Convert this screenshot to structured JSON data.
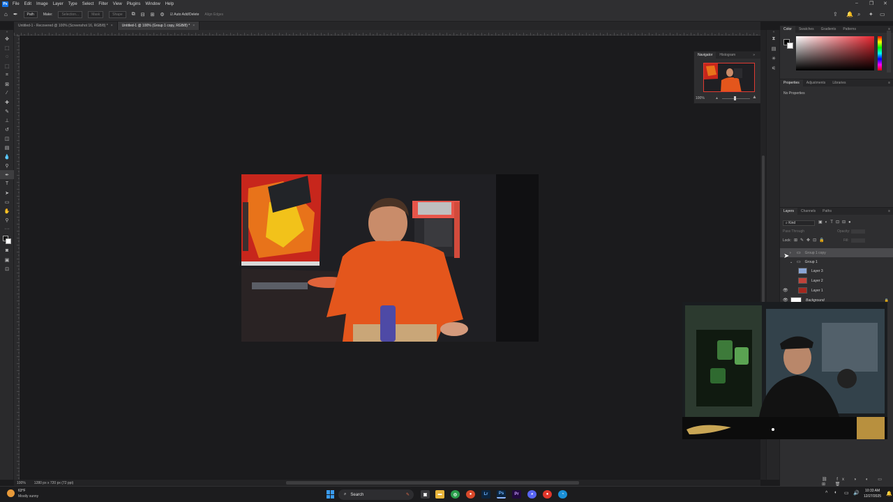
{
  "menubar": {
    "app_icon": "Ps",
    "items": [
      "File",
      "Edit",
      "Image",
      "Layer",
      "Type",
      "Select",
      "Filter",
      "View",
      "Plugins",
      "Window",
      "Help"
    ]
  },
  "options": {
    "home_icon": "home-icon",
    "tool_icon": "pen-icon",
    "mode_value": "Path",
    "make_label": "Make:",
    "selection_label": "Selection...",
    "mask_label": "Mask",
    "shape_label": "Shape",
    "auto_add_delete_label": "Auto Add/Delete",
    "align_edges_label": "Align Edges"
  },
  "tabs": [
    {
      "label": "Untitled-1 - Recovered @ 100% (Screenshot 16, RGB/8) *"
    },
    {
      "label": "Untitled-1 @ 100% (Group 1 copy, RGB/8) *"
    }
  ],
  "navigator": {
    "tabs": [
      "Navigator",
      "Histogram"
    ],
    "zoom": "100%"
  },
  "color_panel": {
    "tabs": [
      "Color",
      "Swatches",
      "Gradients",
      "Patterns"
    ],
    "hue_color": "#e8252f"
  },
  "properties_panel": {
    "tabs": [
      "Properties",
      "Adjustments",
      "Libraries"
    ],
    "empty_text": "No Properties"
  },
  "layers_panel": {
    "tabs": [
      "Layers",
      "Channels",
      "Paths"
    ],
    "filter_value": "Kind",
    "blend_mode": "Pass Through",
    "opacity_label": "Opacity:",
    "lock_label": "Lock:",
    "fill_label": "Fill:",
    "layers": [
      {
        "name": "Group 1 copy",
        "type": "group",
        "visible": false,
        "selected": true
      },
      {
        "name": "Group 1",
        "type": "group",
        "visible": false,
        "selected": false
      },
      {
        "name": "Layer 3",
        "type": "layer",
        "visible": false,
        "selected": false
      },
      {
        "name": "Layer 2",
        "type": "layer",
        "visible": false,
        "selected": false
      },
      {
        "name": "Layer 1",
        "type": "layer",
        "visible": true,
        "selected": false
      },
      {
        "name": "Background",
        "type": "background",
        "visible": true,
        "selected": false
      }
    ]
  },
  "status": {
    "zoom": "100%",
    "doc_info": "1280 px x 720 px (72 ppi)"
  },
  "taskbar": {
    "weather_temp": "63°F",
    "weather_desc": "Mostly sunny",
    "search_label": "Search",
    "clock_time": "10:33 AM",
    "clock_date": "12/27/2025",
    "apps": [
      "Lr",
      "Ps",
      "Pr"
    ]
  }
}
